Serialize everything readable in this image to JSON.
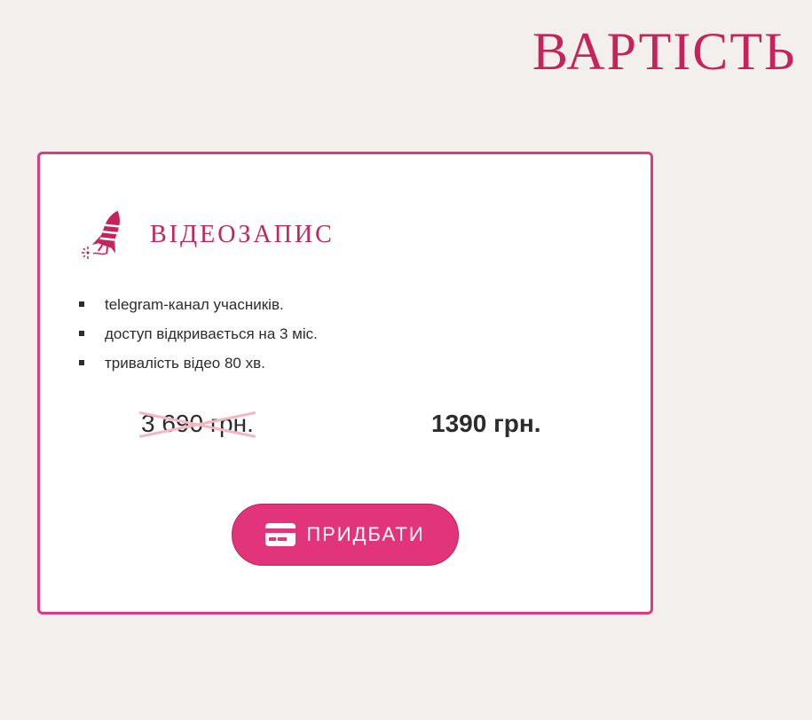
{
  "section": {
    "title": "ВАРТІСТЬ"
  },
  "card": {
    "title": "ВІДЕОЗАПИС",
    "icon": "rocket-icon",
    "features": [
      "telegram-канал учасників.",
      "доступ відкривається на 3 міс.",
      "тривалість відео 80 хв."
    ],
    "old_price": "3 690 грн.",
    "new_price": "1390 грн.",
    "button": {
      "label": "ПРИДБАТИ",
      "icon": "credit-card-icon"
    }
  },
  "colors": {
    "background": "#f3efec",
    "accent": "#c3245c",
    "border": "#dd3a80",
    "button": "#e2347a",
    "strike": "#f4b6c2"
  }
}
